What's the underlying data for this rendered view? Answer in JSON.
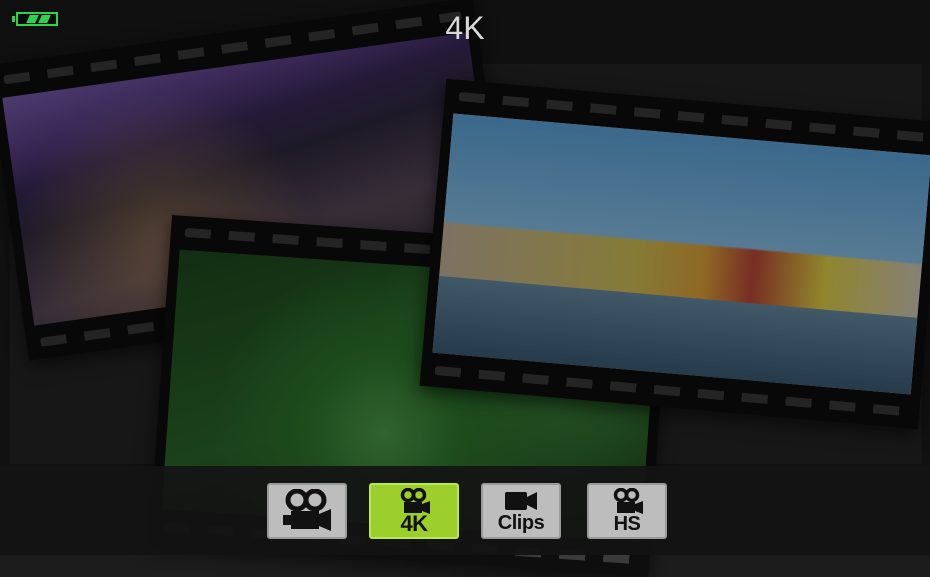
{
  "header": {
    "title": "4K",
    "battery_icon": "battery-icon"
  },
  "modes": [
    {
      "id": "movie",
      "icon": "movie-camera-icon",
      "label": "",
      "selected": false
    },
    {
      "id": "4k",
      "icon": "movie-camera-icon",
      "label": "4K",
      "selected": true
    },
    {
      "id": "clips",
      "icon": "video-camera-icon",
      "label": "Clips",
      "selected": false
    },
    {
      "id": "hs",
      "icon": "movie-camera-icon",
      "label": "HS",
      "selected": false
    }
  ],
  "colors": {
    "accent": "#9ccf2c",
    "battery": "#2fd34a"
  }
}
